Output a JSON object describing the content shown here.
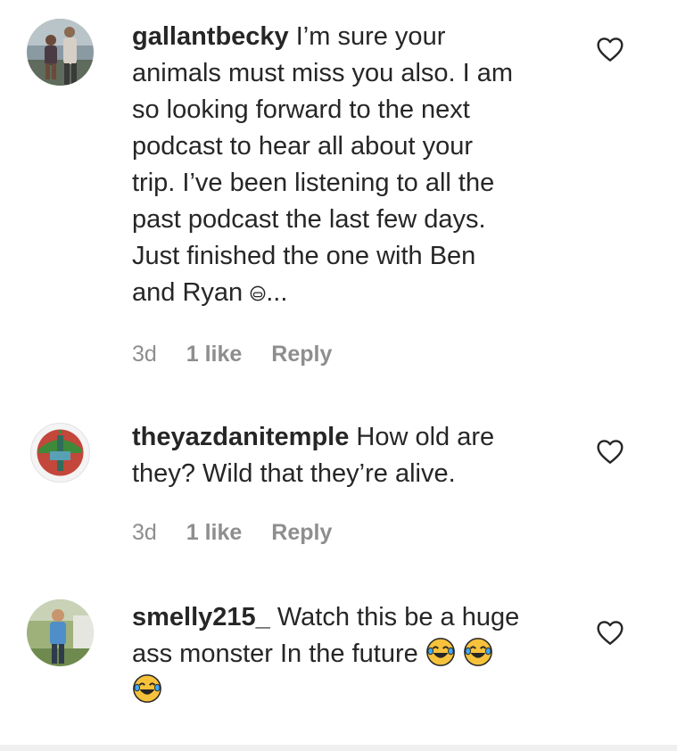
{
  "comments": [
    {
      "username": "gallantbecky",
      "text": "I’m sure your animals must miss you also. I am so looking forward to the next podcast to hear all about your trip. I’ve been listening to all the past podcast the last few days. Just finished the one with Ben and Ryan",
      "lines": [
        "I’m sure your",
        "animals must miss you also. I am",
        "so looking forward to the next",
        "podcast to hear all about your",
        "trip. I’ve been listening to all the",
        "past podcast the last few days.",
        "Just finished the one with Ben",
        "and Ryan"
      ],
      "truncation": "...",
      "age": "3d",
      "likes": "1 like",
      "reply_label": "Reply",
      "avatar_icon": "people-photo-avatar",
      "like_icon": "heart-outline-icon"
    },
    {
      "username": "theyazdanitemple",
      "lines": [
        "How old are",
        "they? Wild that they’re alive."
      ],
      "age": "3d",
      "likes": "1 like",
      "reply_label": "Reply",
      "avatar_icon": "temple-logo-avatar",
      "like_icon": "heart-outline-icon"
    },
    {
      "username": "smelly215_",
      "lines": [
        "Watch this be a huge",
        "ass monster In the future"
      ],
      "emojis": [
        "face-with-tears-of-joy",
        "face-with-tears-of-joy",
        "face-with-tears-of-joy"
      ],
      "avatar_icon": "person-outdoors-avatar",
      "like_icon": "heart-outline-icon"
    }
  ],
  "colors": {
    "text": "#262626",
    "secondary": "#8e8e8e",
    "emoji_yellow": "#f7c23b"
  }
}
